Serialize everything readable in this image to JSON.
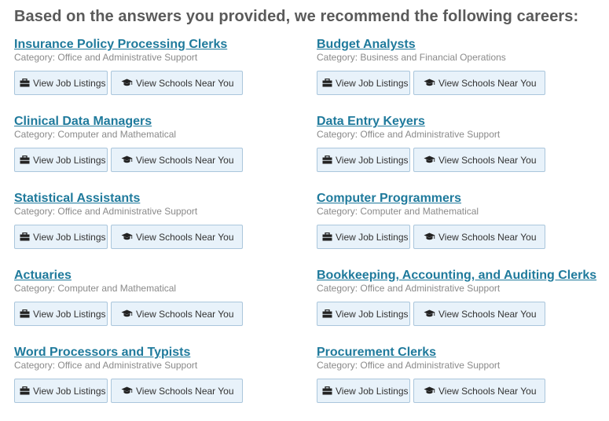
{
  "heading": "Based on the answers you provided, we recommend the following careers:",
  "buttons": {
    "jobs_label": "View Job Listings",
    "jobs_icon": "briefcase-icon",
    "schools_label": "View Schools Near You",
    "schools_icon": "graduation-cap-icon"
  },
  "careers": [
    {
      "title": "Insurance Policy Processing Clerks",
      "category": "Category: Office and Administrative Support"
    },
    {
      "title": "Budget Analysts",
      "category": "Category: Business and Financial Operations"
    },
    {
      "title": "Clinical Data Managers",
      "category": "Category: Computer and Mathematical"
    },
    {
      "title": "Data Entry Keyers",
      "category": "Category: Office and Administrative Support"
    },
    {
      "title": "Statistical Assistants",
      "category": "Category: Office and Administrative Support"
    },
    {
      "title": "Computer Programmers",
      "category": "Category: Computer and Mathematical"
    },
    {
      "title": "Actuaries",
      "category": "Category: Computer and Mathematical"
    },
    {
      "title": "Bookkeeping, Accounting, and Auditing Clerks",
      "category": "Category: Office and Administrative Support"
    },
    {
      "title": "Word Processors and Typists",
      "category": "Category: Office and Administrative Support"
    },
    {
      "title": "Procurement Clerks",
      "category": "Category: Office and Administrative Support"
    }
  ],
  "colors": {
    "link": "#1f7a9c",
    "button_bg": "#e8f2fa",
    "button_border": "#aac6dc"
  }
}
